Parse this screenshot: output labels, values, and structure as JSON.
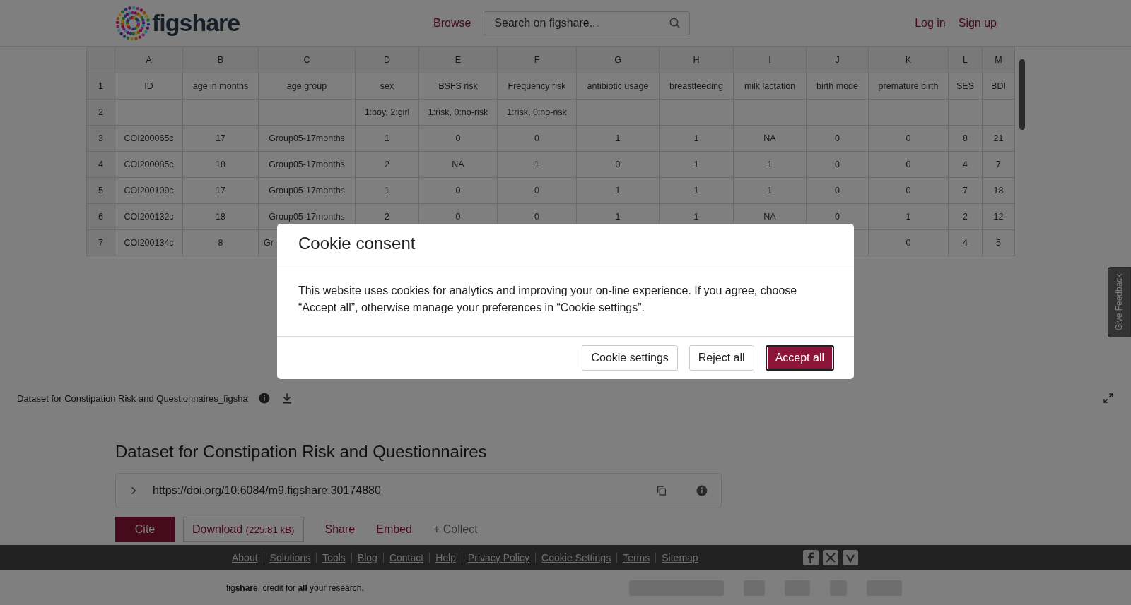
{
  "header": {
    "logo_text": "figshare",
    "nav_link": "Browse",
    "search": {
      "placeholder": "Search on figshare..."
    },
    "auth_links": [
      "Log in",
      "Sign up"
    ]
  },
  "spreadsheet": {
    "column_letters": [
      "A",
      "B",
      "C",
      "D",
      "E",
      "F",
      "G",
      "H",
      "I",
      "J",
      "K",
      "L",
      "M"
    ],
    "rows": [
      {
        "number": "1",
        "cells": [
          "ID",
          "age in months",
          "age group",
          "sex",
          "BSFS risk",
          "Frequency risk",
          "antibiotic usage",
          "breastfeeding",
          "milk lactation",
          "birth mode",
          "premature birth",
          "SES",
          "BDI"
        ]
      },
      {
        "number": "2",
        "cells": [
          null,
          null,
          null,
          "1:boy, 2:girl",
          "1:risk, 0:no-risk",
          "1:risk, 0:no-risk",
          null,
          null,
          null,
          null,
          null,
          null,
          null
        ]
      },
      {
        "number": "3",
        "cells": [
          "COI200065c",
          "17",
          "Group05-17months",
          "1",
          "0",
          "0",
          "1",
          "1",
          "NA",
          "0",
          "0",
          "8",
          "21"
        ]
      },
      {
        "number": "4",
        "cells": [
          "COI200085c",
          "18",
          "Group05-17months",
          "2",
          "NA",
          "1",
          "0",
          "1",
          "1",
          "0",
          "0",
          "4",
          "7"
        ]
      },
      {
        "number": "5",
        "cells": [
          "COI200109c",
          "17",
          "Group05-17months",
          "1",
          "0",
          "0",
          "1",
          "1",
          "1",
          "0",
          "0",
          "7",
          "18"
        ]
      },
      {
        "number": "6",
        "cells": [
          "COI200132c",
          "18",
          "Group05-17months",
          "2",
          "0",
          "0",
          "1",
          "1",
          "NA",
          "0",
          "1",
          "2",
          "12"
        ]
      },
      {
        "number": "7",
        "cells": [
          "COI200134c",
          "8",
          "Gr",
          null,
          null,
          null,
          null,
          null,
          null,
          null,
          "0",
          "4",
          "5"
        ]
      }
    ]
  },
  "file_bar": {
    "file_name": "Dataset for Constipation Risk and Questionnaires_figsha"
  },
  "item": {
    "title": "Dataset for Constipation Risk and Questionnaires",
    "doi": "https://doi.org/10.6084/m9.figshare.30174880",
    "cite": "Cite",
    "download": {
      "label": "Download",
      "size": "(225.81 kB)"
    },
    "share": "Share",
    "embed": "Embed",
    "collect": "+ Collect"
  },
  "footer": {
    "links": [
      "About",
      "Solutions",
      "Tools",
      "Blog",
      "Contact",
      "Help",
      "Privacy Policy",
      "Cookie Settings",
      "Terms",
      "Sitemap"
    ],
    "tagline": "fig**share**. credit for **all** your research."
  },
  "feedback_tab": "Give Feedback",
  "cookie_dialog": {
    "title": "Cookie consent",
    "message": "This website uses cookies for analytics and improving your on-line experience. If you agree, choose “Accept all”, otherwise manage your preferences in “Cookie settings”.",
    "buttons": [
      {
        "label": "Cookie settings",
        "kind": "secondary"
      },
      {
        "label": "Reject all",
        "kind": "secondary"
      },
      {
        "label": "Accept all",
        "kind": "primary"
      }
    ]
  }
}
